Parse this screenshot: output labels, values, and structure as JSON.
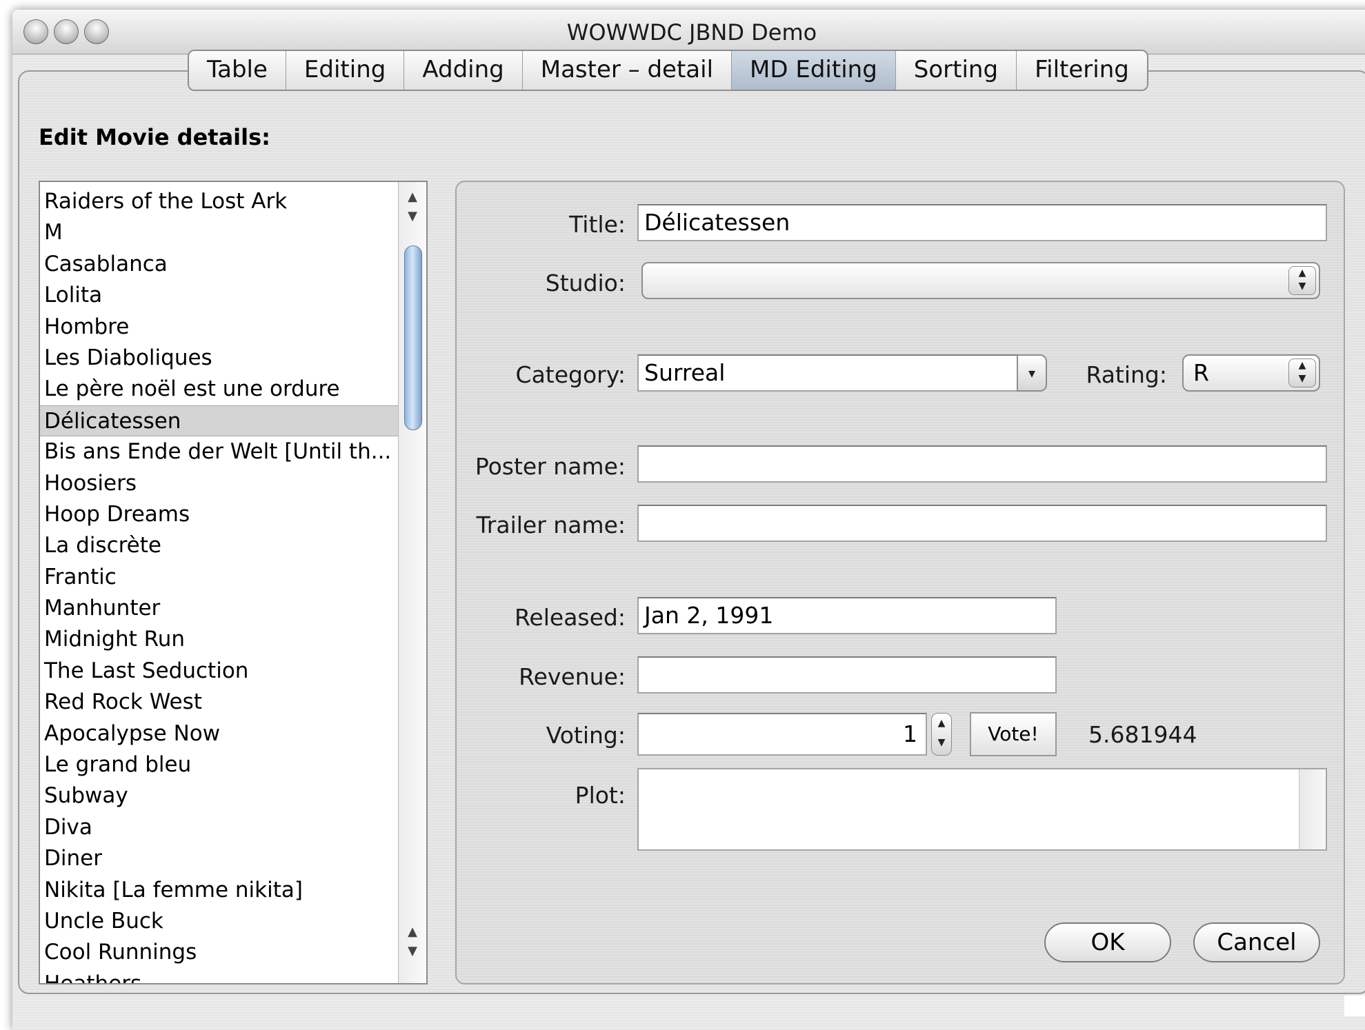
{
  "window": {
    "title": "WOWWDC JBND Demo"
  },
  "tabs": [
    {
      "label": "Table"
    },
    {
      "label": "Editing"
    },
    {
      "label": "Adding"
    },
    {
      "label": "Master – detail"
    },
    {
      "label": "MD Editing",
      "selected": true
    },
    {
      "label": "Sorting"
    },
    {
      "label": "Filtering"
    }
  ],
  "heading": "Edit Movie details:",
  "movies": {
    "selected_index": 7,
    "items": [
      "Raiders of the Lost Ark",
      "M",
      "Casablanca",
      "Lolita",
      "Hombre",
      "Les Diaboliques",
      "Le père noël est une ordure",
      "Délicatessen",
      "Bis ans Ende der Welt [Until th...",
      "Hoosiers",
      "Hoop Dreams",
      "La discrète",
      "Frantic",
      "Manhunter",
      "Midnight Run",
      "The Last Seduction",
      "Red Rock West",
      "Apocalypse Now",
      "Le grand bleu",
      "Subway",
      "Diva",
      "Diner",
      "Nikita [La femme nikita]",
      "Uncle Buck",
      "Cool Runnings",
      "Heathers"
    ]
  },
  "form": {
    "title_label": "Title:",
    "title_value": "Délicatessen",
    "studio_label": "Studio:",
    "studio_value": "",
    "category_label": "Category:",
    "category_value": "Surreal",
    "rating_label": "Rating:",
    "rating_value": "R",
    "poster_label": "Poster name:",
    "poster_value": "",
    "trailer_label": "Trailer name:",
    "trailer_value": "",
    "released_label": "Released:",
    "released_value": "Jan 2, 1991",
    "revenue_label": "Revenue:",
    "revenue_value": "",
    "voting_label": "Voting:",
    "voting_value": "1",
    "vote_button": "Vote!",
    "vote_average": "5.681944",
    "plot_label": "Plot:",
    "plot_value": "",
    "ok_button": "OK",
    "cancel_button": "Cancel"
  },
  "icons": {
    "up": "up-arrow-icon",
    "down": "down-arrow-icon",
    "chevron": "chevron-down-icon",
    "updown": "up-down-icon"
  }
}
